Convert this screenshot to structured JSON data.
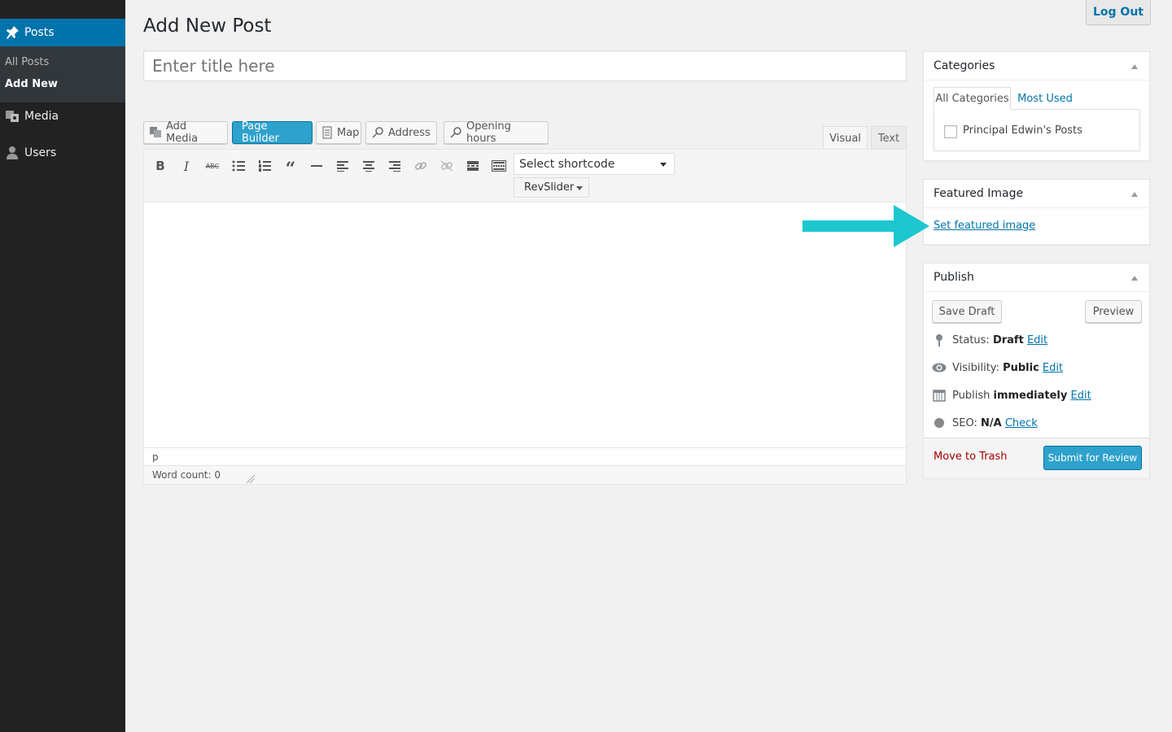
{
  "sidebar": {
    "posts_label": "Posts",
    "sub_all_posts": "All Posts",
    "sub_add_new": "Add New",
    "media_label": "Media",
    "users_label": "Users"
  },
  "header": {
    "title": "Add New Post",
    "logout": "Log Out"
  },
  "title_input": {
    "placeholder": "Enter title here"
  },
  "media_buttons": {
    "add_media": "Add Media",
    "page_builder": "Page Builder",
    "map": "Map",
    "address": "Address",
    "opening_hours": "Opening hours"
  },
  "editor_tabs": {
    "visual": "Visual",
    "text": "Text"
  },
  "toolbar": {
    "shortcode_select": "Select shortcode",
    "revslider": "RevSlider"
  },
  "editor": {
    "path": "p",
    "word_count": "Word count: 0"
  },
  "categories": {
    "title": "Categories",
    "tab_all": "All Categories",
    "tab_most_used": "Most Used",
    "items": [
      "Principal Edwin's Posts"
    ]
  },
  "featured_image": {
    "title": "Featured Image",
    "link": "Set featured image",
    "arrow_color": "#1cc7cf"
  },
  "publish": {
    "title": "Publish",
    "save_draft": "Save Draft",
    "preview": "Preview",
    "status_label": "Status:",
    "status_value": "Draft",
    "visibility_label": "Visibility:",
    "visibility_value": "Public",
    "publish_label": "Publish",
    "publish_value": "immediately",
    "seo_label": "SEO:",
    "seo_value": "N/A",
    "edit": "Edit",
    "check": "Check",
    "trash": "Move to Trash",
    "submit": "Submit for Review"
  },
  "colors": {
    "accent": "#0073aa",
    "primary_button": "#2ea2cc",
    "sidebar_bg": "#222222",
    "trash": "#a00000"
  }
}
